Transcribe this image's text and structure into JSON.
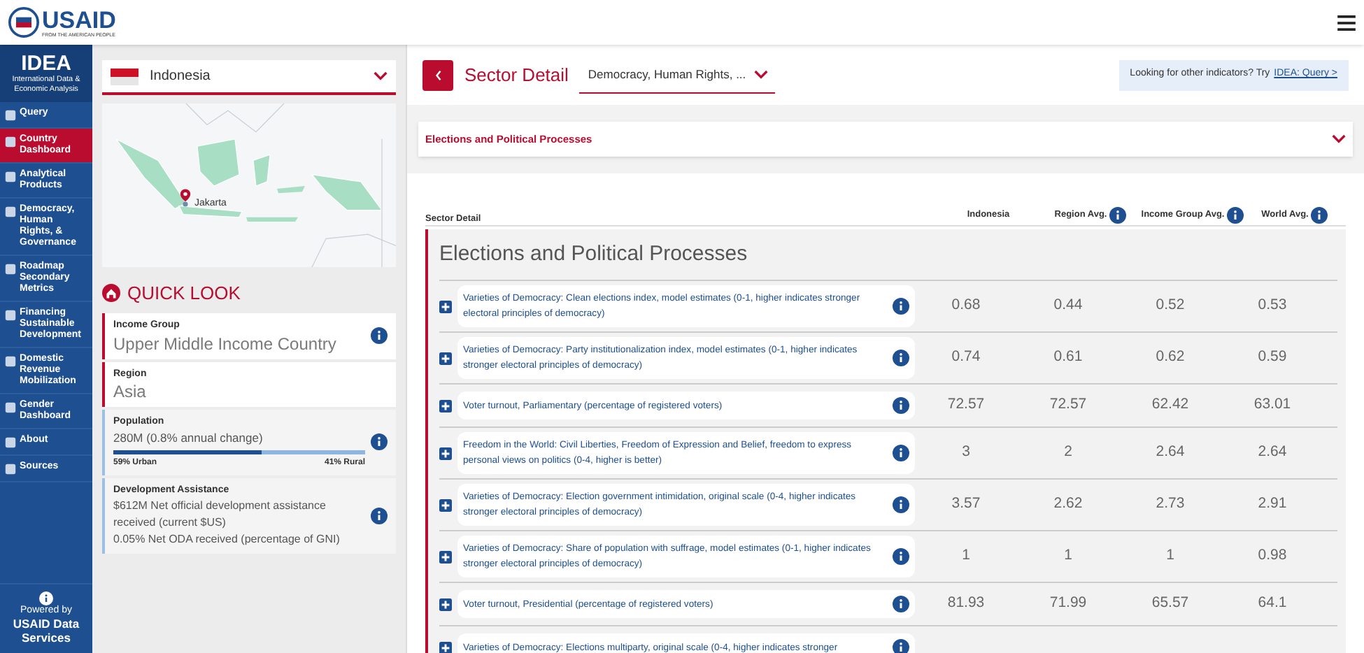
{
  "header": {
    "logo_text": "USAID",
    "logo_tagline": "FROM THE AMERICAN PEOPLE"
  },
  "sidebar": {
    "title": "IDEA",
    "subtitle": "International Data & Economic Analysis",
    "items": [
      {
        "label": "Query",
        "selected": false
      },
      {
        "label": "Country Dashboard",
        "selected": true
      },
      {
        "label": "Analytical Products",
        "selected": false
      },
      {
        "label": "Democracy, Human Rights, & Governance",
        "selected": false
      },
      {
        "label": "Roadmap Secondary Metrics",
        "selected": false
      },
      {
        "label": "Financing Sustainable Development",
        "selected": false
      },
      {
        "label": "Domestic Revenue Mobilization",
        "selected": false
      },
      {
        "label": "Gender Dashboard",
        "selected": false
      },
      {
        "label": "About",
        "selected": false
      },
      {
        "label": "Sources",
        "selected": false
      }
    ],
    "footer": {
      "caption": "Powered by",
      "name": "USAID Data Services"
    }
  },
  "country": {
    "value": "Indonesia",
    "marker": "Jakarta"
  },
  "quick_look": {
    "title": "QUICK LOOK",
    "income_group": {
      "label": "Income Group",
      "value": "Upper Middle Income Country"
    },
    "region": {
      "label": "Region",
      "value": "Asia"
    },
    "population": {
      "label": "Population",
      "value": "280M (0.8% annual change)",
      "level": 0.59,
      "left": "59% Urban",
      "right": "41% Rural"
    },
    "assistance": {
      "label": "Development Assistance",
      "lines": [
        "$612M Net official development assistance received (current $US)",
        "0.05% Net ODA received (percentage of GNI)"
      ]
    }
  },
  "sector": {
    "title": "Sector Detail",
    "dropdown": "Democracy, Human Rights, ...",
    "hint": "Looking for other indicators? Try",
    "hint_link": "IDEA: Query >",
    "accordion": "Elections and Political Processes"
  },
  "table": {
    "columns": [
      "Sector Detail",
      "Indonesia",
      "Region Avg.",
      "Income Group Avg.",
      "World Avg."
    ],
    "group": "Elections and Political Processes",
    "rows": [
      {
        "label": "Varieties of Democracy: Clean elections index, model estimates (0-1, higher indicates stronger electoral principles of democracy)",
        "values": [
          "0.68",
          "0.44",
          "0.52",
          "0.53"
        ]
      },
      {
        "label": "Varieties of Democracy: Party institutionalization index, model estimates (0-1, higher indicates stronger electoral principles of democracy)",
        "values": [
          "0.74",
          "0.61",
          "0.62",
          "0.59"
        ]
      },
      {
        "label": "Voter turnout, Parliamentary (percentage of registered voters)",
        "values": [
          "72.57",
          "72.57",
          "62.42",
          "63.01"
        ]
      },
      {
        "label": "Freedom in the World: Civil Liberties, Freedom of Expression and Belief, freedom to express personal views on politics (0-4, higher is better)",
        "values": [
          "3",
          "2",
          "2.64",
          "2.64"
        ]
      },
      {
        "label": "Varieties of Democracy: Election government intimidation, original scale (0-4, higher indicates stronger electoral principles of democracy)",
        "values": [
          "3.57",
          "2.62",
          "2.73",
          "2.91"
        ]
      },
      {
        "label": "Varieties of Democracy: Share of population with suffrage, model estimates (0-1, higher indicates stronger electoral principles of democracy)",
        "values": [
          "1",
          "1",
          "1",
          "0.98"
        ]
      },
      {
        "label": "Voter turnout, Presidential (percentage of registered voters)",
        "values": [
          "81.93",
          "71.99",
          "65.57",
          "64.1"
        ]
      },
      {
        "label": "Varieties of Democracy: Elections multiparty, original scale (0-4, higher indicates stronger"
      }
    ]
  }
}
